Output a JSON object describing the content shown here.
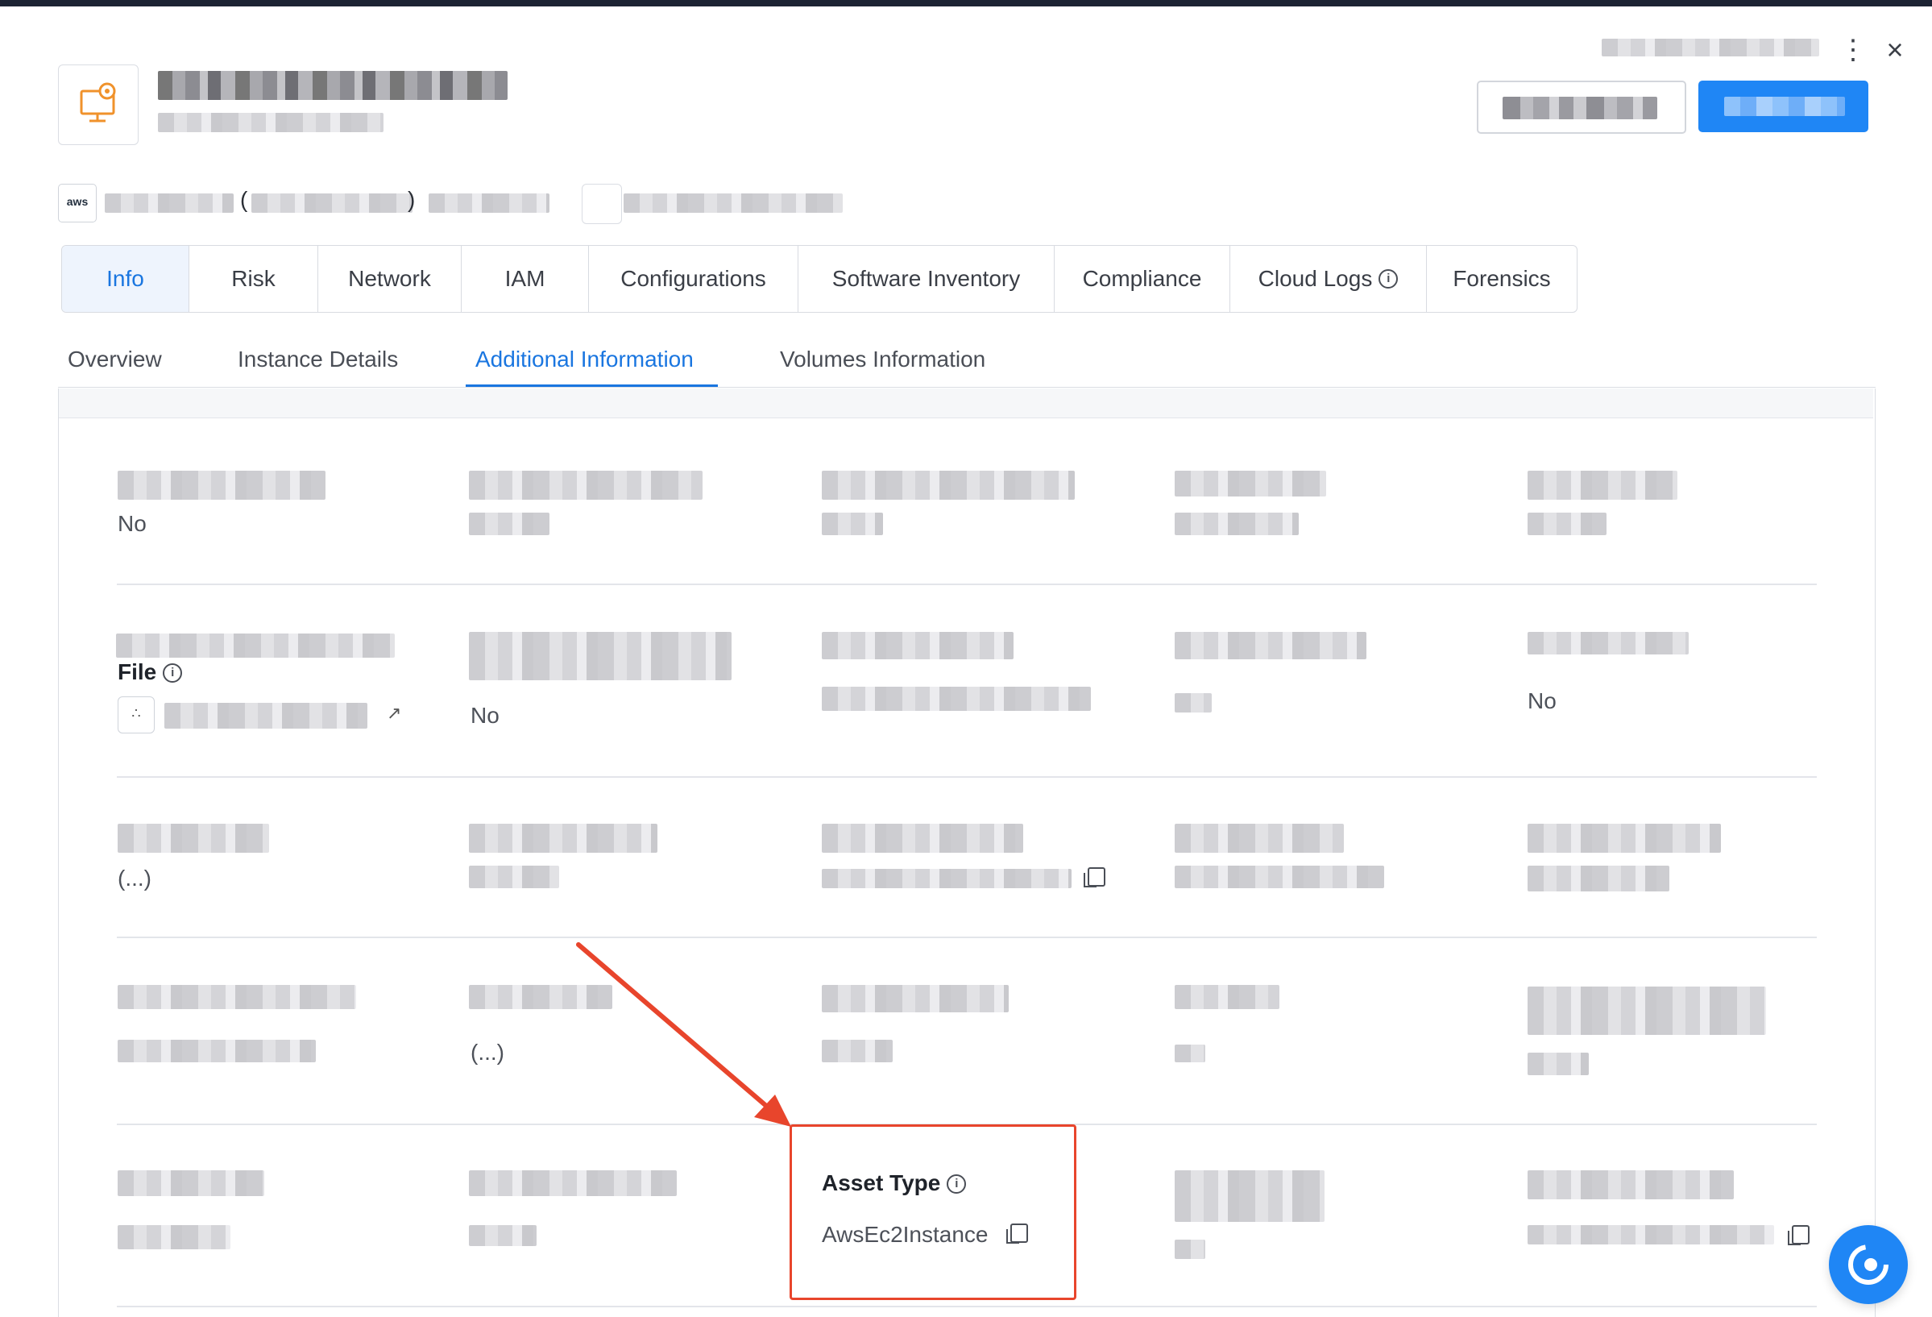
{
  "window": {
    "kebab_icon": "⋮",
    "close_icon": "×"
  },
  "asset": {
    "provider_badge": "aws",
    "paren_open": "(",
    "paren_close": ")"
  },
  "tabs": [
    {
      "label": "Info",
      "active": true
    },
    {
      "label": "Risk"
    },
    {
      "label": "Network"
    },
    {
      "label": "IAM"
    },
    {
      "label": "Configurations"
    },
    {
      "label": "Software Inventory"
    },
    {
      "label": "Compliance"
    },
    {
      "label": "Cloud Logs"
    },
    {
      "label": "Forensics"
    }
  ],
  "subtabs": [
    {
      "label": "Overview"
    },
    {
      "label": "Instance Details"
    },
    {
      "label": "Additional Information",
      "active": true
    },
    {
      "label": "Volumes Information"
    }
  ],
  "fields": {
    "r1c1_value": "No",
    "r2c1_label": "File",
    "r2c2_value": "No",
    "r2c5_value": "No",
    "r3c1_value": "(...)",
    "r4c2_value": "(...)",
    "asset_type_label": "Asset Type",
    "asset_type_value": "AwsEc2Instance"
  },
  "colors": {
    "accent": "#1a76e0",
    "primary_button": "#1f86f5",
    "highlight": "#e8452c",
    "app_icon": "#f0922b"
  }
}
